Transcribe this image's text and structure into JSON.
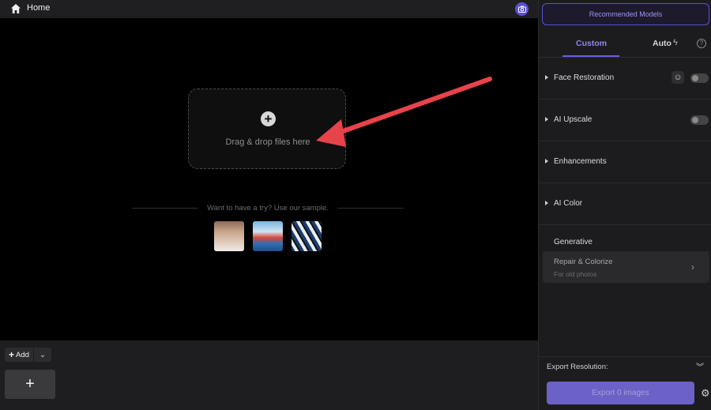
{
  "topbar": {
    "home_label": "Home"
  },
  "dropzone": {
    "text": "Drag & drop files here"
  },
  "samples": {
    "prompt": "Want to have a try? Use our sample."
  },
  "tray": {
    "add_label": "Add"
  },
  "panel": {
    "recommended_label": "Recommended Models",
    "tabs": {
      "custom": "Custom",
      "auto": "Auto"
    },
    "sections": [
      {
        "label": "Face Restoration"
      },
      {
        "label": "AI Upscale"
      },
      {
        "label": "Enhancements"
      },
      {
        "label": "AI Color"
      }
    ],
    "generative_label": "Generative",
    "repair": {
      "title": "Repair & Colorize",
      "subtitle": "For old photos"
    },
    "export_resolution_label": "Export Resolution:",
    "export_button_label": "Export 0 images"
  },
  "colors": {
    "accent": "#5b4fd6",
    "arrow": "#e8434a"
  }
}
